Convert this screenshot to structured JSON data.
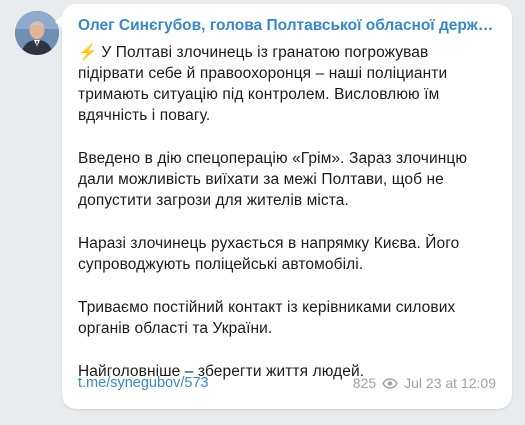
{
  "channel": {
    "author": "Олег Синєгубов, голова Полтавської обласної держа...",
    "avatar_icon": "person-avatar-icon"
  },
  "message": {
    "emoji": "⚡",
    "paragraphs": [
      "У Полтаві злочинець із гранатою погрожував підірвати себе й правоохоронця – наші поліцианти тримають ситуацію під контролем. Висловлюю їм вдячність і повагу.",
      "Введено в дію спецоперацію «Грім». Зараз злочинцю дали можливість виїхати за межі Полтави, щоб не допустити загрози для жителів міста.",
      "Наразі злочинець рухається в напрямку Києва. Його супроводжують поліцейські автомобілі.",
      "Триваємо постійний контакт із керівниками силових органів області та України.",
      "Найголовніше – зберегти життя людей."
    ]
  },
  "footer": {
    "link": "t.me/synegubov/573",
    "views": "825",
    "views_icon": "eye-icon",
    "timestamp": "Jul 23 at 12:09"
  },
  "colors": {
    "background": "#e9ecef",
    "bubble": "#ffffff",
    "accent": "#3a87c8",
    "muted": "#9aa3ad",
    "bolt": "#f5b301"
  }
}
